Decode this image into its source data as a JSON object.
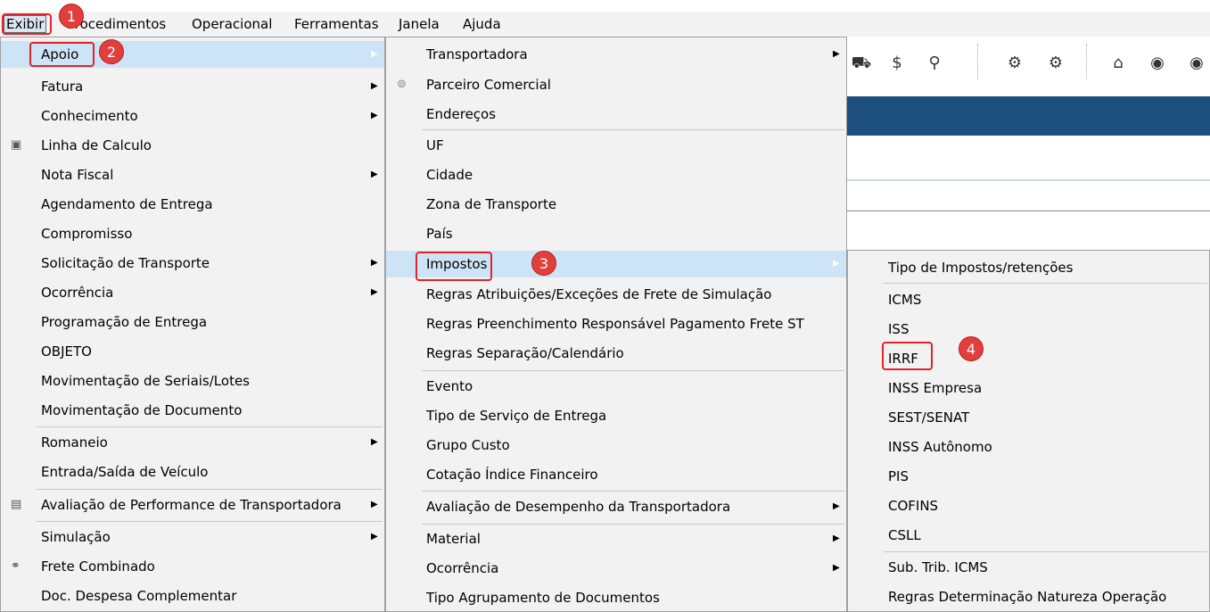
{
  "menubar": {
    "items": [
      "Exibir",
      "Procedimentos",
      "Operacional",
      "Ferramentas",
      "Janela",
      "Ajuda"
    ]
  },
  "menu1": {
    "items": [
      {
        "label": "Apoio",
        "submenu": true
      },
      {
        "label": "Fatura",
        "submenu": true
      },
      {
        "label": "Conhecimento",
        "submenu": true
      },
      {
        "label": "Linha de Calculo",
        "icon": "calculator-icon"
      },
      {
        "label": "Nota Fiscal",
        "submenu": true
      },
      {
        "label": "Agendamento de Entrega"
      },
      {
        "label": "Compromisso"
      },
      {
        "label": "Solicitação de Transporte",
        "submenu": true
      },
      {
        "label": "Ocorrência",
        "submenu": true
      },
      {
        "label": "Programação de Entrega"
      },
      {
        "label": "OBJETO"
      },
      {
        "label": "Movimentação de Seriais/Lotes"
      },
      {
        "label": "Movimentação de Documento"
      },
      {
        "label": "Romaneio",
        "submenu": true
      },
      {
        "label": "Entrada/Saída de Veículo"
      },
      {
        "label": "Avaliação de Performance de Transportadora",
        "submenu": true,
        "icon": "report-icon"
      },
      {
        "label": "Simulação",
        "submenu": true
      },
      {
        "label": "Frete Combinado",
        "icon": "combined-freight-icon"
      },
      {
        "label": "Doc. Despesa Complementar"
      }
    ]
  },
  "menu2": {
    "items": [
      {
        "label": "Transportadora",
        "submenu": true
      },
      {
        "label": "Parceiro Comercial",
        "icon": "partner-icon"
      },
      {
        "label": "Endereços"
      },
      {
        "label": "UF"
      },
      {
        "label": "Cidade"
      },
      {
        "label": "Zona de Transporte"
      },
      {
        "label": "País"
      },
      {
        "label": "Impostos",
        "submenu": true
      },
      {
        "label": "Regras Atribuições/Exceções de Frete de Simulação"
      },
      {
        "label": "Regras Preenchimento Responsável Pagamento Frete ST"
      },
      {
        "label": "Regras Separação/Calendário"
      },
      {
        "label": "Evento"
      },
      {
        "label": "Tipo de Serviço de Entrega"
      },
      {
        "label": "Grupo Custo"
      },
      {
        "label": "Cotação Índice Financeiro"
      },
      {
        "label": "Avaliação de Desempenho da Transportadora",
        "submenu": true
      },
      {
        "label": "Material",
        "submenu": true
      },
      {
        "label": "Ocorrência",
        "submenu": true
      },
      {
        "label": "Tipo Agrupamento de Documentos"
      }
    ]
  },
  "menu3": {
    "items": [
      {
        "label": "Tipo de Impostos/retenções"
      },
      {
        "label": "ICMS"
      },
      {
        "label": "ISS"
      },
      {
        "label": "IRRF"
      },
      {
        "label": "INSS Empresa"
      },
      {
        "label": "SEST/SENAT"
      },
      {
        "label": "INSS Autônomo"
      },
      {
        "label": "PIS"
      },
      {
        "label": "COFINS"
      },
      {
        "label": "CSLL"
      },
      {
        "label": "Sub. Trib. ICMS"
      },
      {
        "label": "Regras Determinação Natureza Operação"
      }
    ]
  },
  "badges": [
    "1",
    "2",
    "3",
    "4"
  ],
  "toolbar": {
    "icons": [
      "truck-route-icon",
      "dollar-pin-icon",
      "map-pin-icon",
      "settings-icon",
      "money-settings-icon",
      "warehouse-icon",
      "user-circle-icon",
      "user-circle-icon-2"
    ]
  },
  "colors": {
    "menu_bg": "#f2f2f2",
    "highlight": "#cde4f7",
    "annotation_red": "#e0242a",
    "header_blue": "#1d4f7e"
  }
}
